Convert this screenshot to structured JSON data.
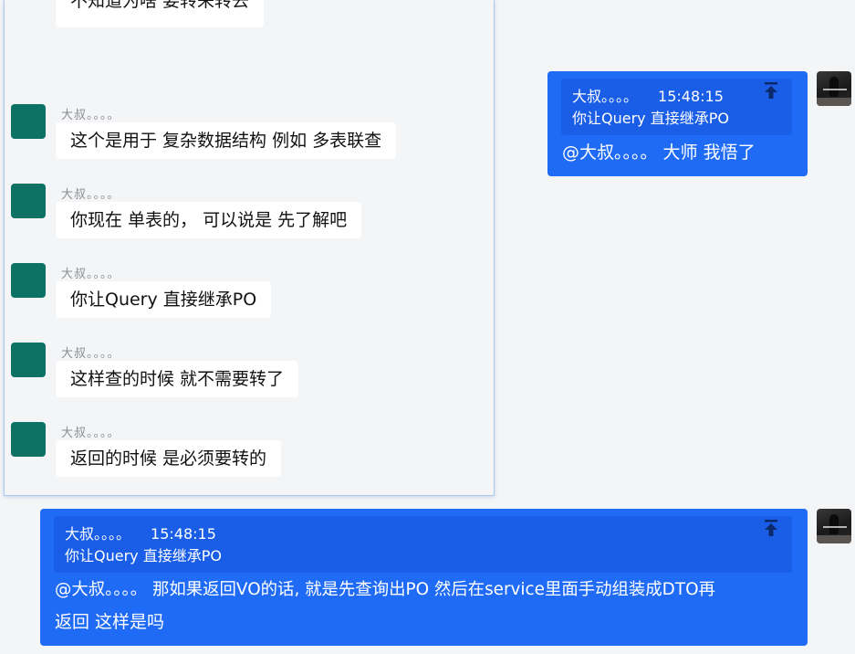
{
  "incoming": {
    "top_partial_message": "不知道为啥 要转来转去",
    "messages": [
      {
        "sender": "大叔。。。。",
        "text": "这个是用于 复杂数据结构 例如 多表联查"
      },
      {
        "sender": "大叔。。。。",
        "text": "你现在 单表的，  可以说是 先了解吧"
      },
      {
        "sender": "大叔。。。。",
        "text": "你让Query 直接继承PO"
      },
      {
        "sender": "大叔。。。。",
        "text": "这样查的时候 就不需要转了"
      },
      {
        "sender": "大叔。。。。",
        "text": "返回的时候 是必须要转的"
      }
    ]
  },
  "outgoing": [
    {
      "quote_sender": "大叔。。。。",
      "quote_time": "15:48:15",
      "quote_text": "你让Query 直接继承PO",
      "text": "@大叔。。。。 大师 我悟了"
    },
    {
      "quote_sender": "大叔。。。。",
      "quote_time": "15:48:15",
      "quote_text": "你让Query 直接继承PO",
      "text_line1": "@大叔。。。。 那如果返回VO的话, 就是先查询出PO 然后在service里面手动组装成DTO再",
      "text_line2": "返回 这样是吗"
    }
  ],
  "icons": {
    "pin": "pin-to-top-icon",
    "avatar": "user-avatar"
  },
  "colors": {
    "outgoing_bubble": "#1f6bf6",
    "quote_block": "#1a5ee8",
    "incoming_avatar": "#0d7264",
    "background": "#f4f5f7"
  }
}
